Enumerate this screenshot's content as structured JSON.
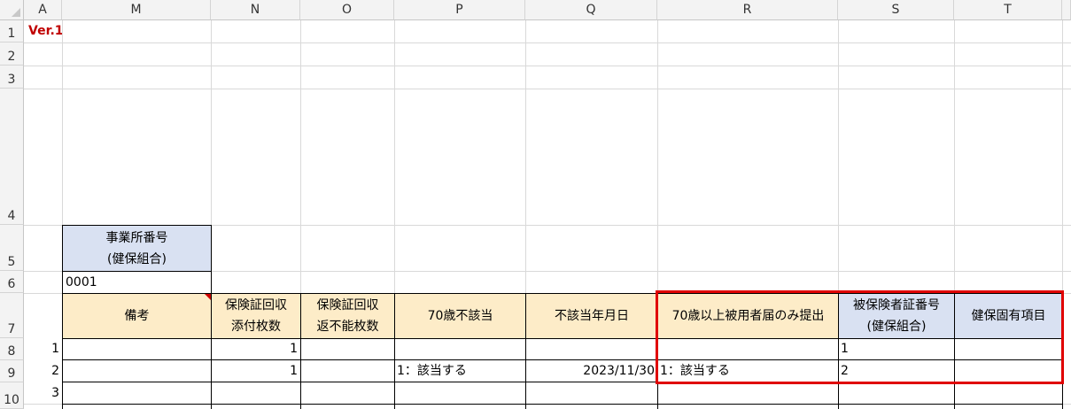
{
  "columns": [
    "A",
    "M",
    "N",
    "O",
    "P",
    "Q",
    "R",
    "S",
    "T"
  ],
  "rows": [
    "1",
    "2",
    "3",
    "4",
    "5",
    "6",
    "7",
    "8",
    "9",
    "10"
  ],
  "version_label": "Ver.1",
  "office_number": {
    "header_line1": "事業所番号",
    "header_line2": "(健保組合)",
    "value": "0001"
  },
  "table_headers": {
    "remarks": "備考",
    "cert_collect_attached": [
      "保険証回収",
      "添付枚数"
    ],
    "cert_collect_unreturnable": [
      "保険証回収",
      "返不能枚数"
    ],
    "age70_not_applicable": "70歳不該当",
    "not_applicable_date": "不該当年月日",
    "age70_over_only": "70歳以上被用者届のみ提出",
    "insured_cert_number": [
      "被保険者証番号",
      "(健保組合)"
    ],
    "kenpo_specific": "健保固有項目"
  },
  "data_rows": [
    {
      "no": "1",
      "remarks": "",
      "attached": "1",
      "unreturnable": "",
      "age70_not_applicable": "",
      "date": "",
      "age70_over_only": "",
      "cert_number": "1",
      "kenpo": ""
    },
    {
      "no": "2",
      "remarks": "",
      "attached": "1",
      "unreturnable": "",
      "age70_not_applicable": "1：該当する",
      "date": "2023/11/30",
      "age70_over_only": "1：該当する",
      "cert_number": "2",
      "kenpo": ""
    },
    {
      "no": "3",
      "remarks": "",
      "attached": "",
      "unreturnable": "",
      "age70_not_applicable": "",
      "date": "",
      "age70_over_only": "",
      "cert_number": "",
      "kenpo": ""
    }
  ],
  "colors": {
    "header_peach": "#fdecc8",
    "header_blue": "#d9e1f2",
    "version_red": "#c00000",
    "highlight_red": "#e00000"
  }
}
